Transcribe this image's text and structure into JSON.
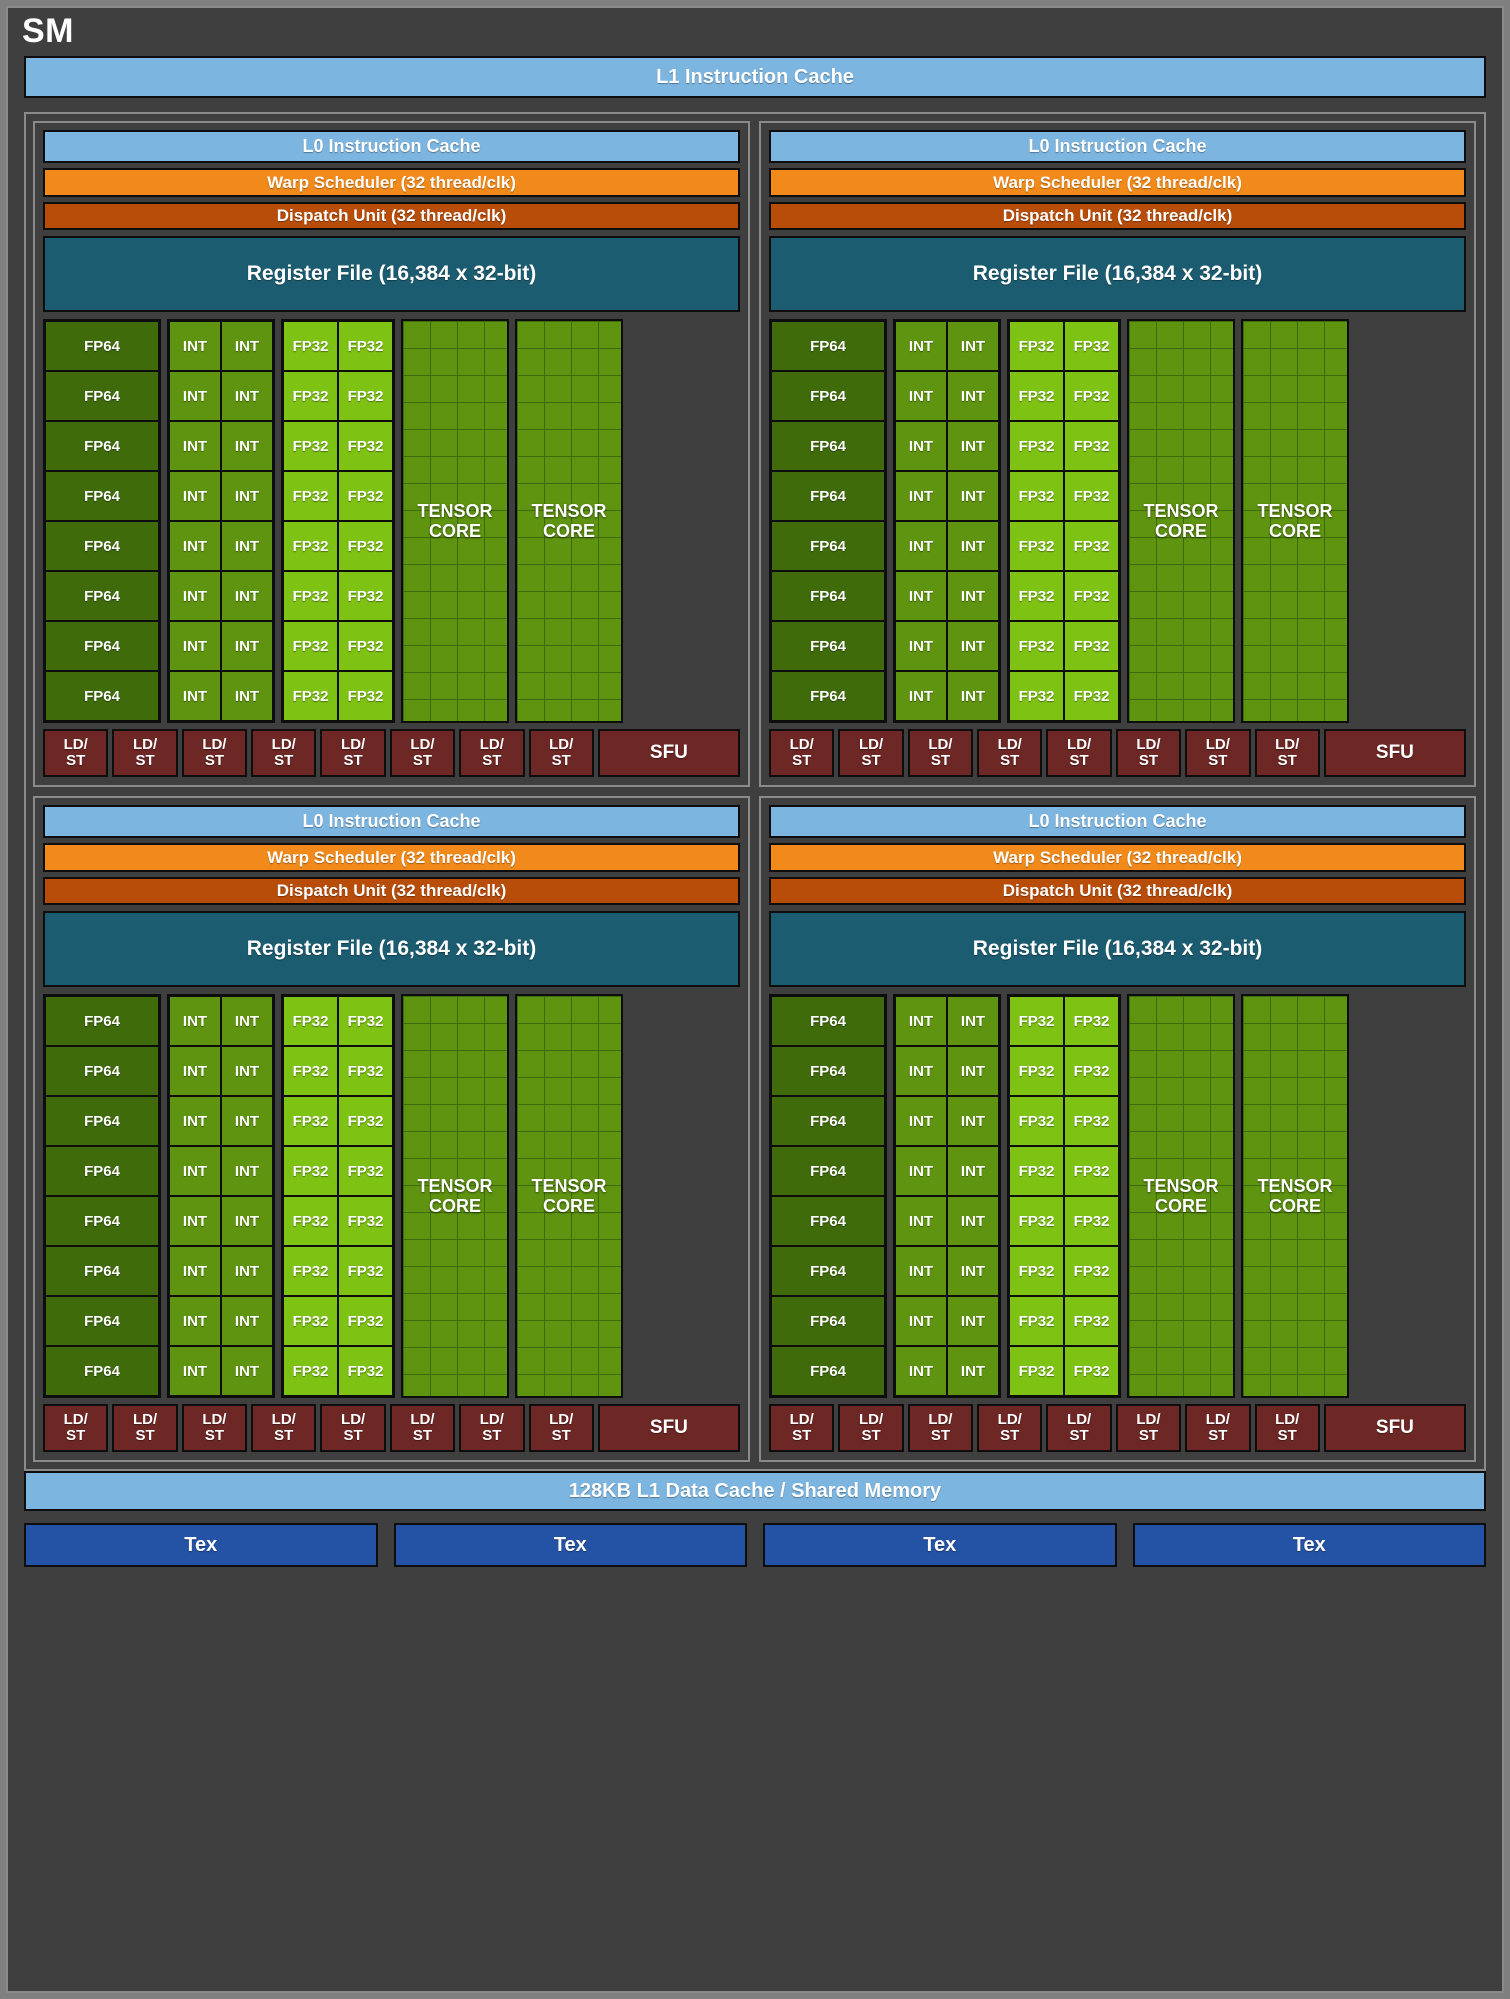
{
  "title": "SM",
  "l1_instruction_cache": "L1 Instruction Cache",
  "l1_data_cache": "128KB L1 Data Cache / Shared Memory",
  "block_labels": {
    "l0_instruction_cache": "L0 Instruction Cache",
    "warp_scheduler": "Warp Scheduler (32 thread/clk)",
    "dispatch_unit": "Dispatch Unit (32 thread/clk)",
    "register_file": "Register File (16,384 x 32-bit)",
    "fp64": "FP64",
    "int": "INT",
    "fp32": "FP32",
    "tensor_core_line1": "TENSOR",
    "tensor_core_line2": "CORE",
    "ldst_line1": "LD/",
    "ldst_line2": "ST",
    "sfu": "SFU"
  },
  "counts": {
    "processing_blocks": 4,
    "fp64_per_block": 8,
    "int_rows_per_block": 8,
    "int_per_row": 2,
    "fp32_rows_per_block": 8,
    "fp32_per_row": 2,
    "tensor_cores_per_block": 2,
    "ldst_per_block": 8,
    "sfu_per_block": 1,
    "tex_units": 4
  },
  "tex_units": [
    "Tex",
    "Tex",
    "Tex",
    "Tex"
  ],
  "colors": {
    "background": "#7f7f7f",
    "chassis": "#3f3f3f",
    "chassis_border": "#8a8a8a",
    "cache_blue": "#7cb5e0",
    "warp_orange": "#f18a1b",
    "dispatch_brown": "#b84c09",
    "register_teal": "#1c5c70",
    "fp64_green": "#3f6b0b",
    "int_green": "#5f9410",
    "fp32_green": "#7ec214",
    "tensor_green": "#5f9410",
    "ldst_maroon": "#6d2725",
    "tex_blue": "#2453a6",
    "text": "#ffffff"
  }
}
